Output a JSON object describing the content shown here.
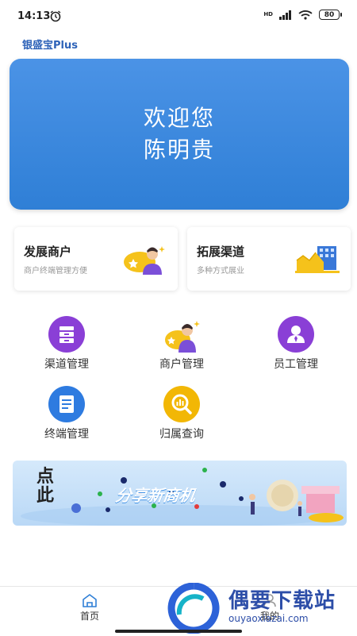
{
  "status": {
    "time": "14:13",
    "network": "HD",
    "battery": "80"
  },
  "app": {
    "title": "银盛宝Plus"
  },
  "welcome": {
    "line1": "欢迎您",
    "line2": "陈明贵"
  },
  "cards": [
    {
      "title": "发展商户",
      "subtitle": "商户终端管理方便",
      "icon": "merchant-avatar-icon"
    },
    {
      "title": "拓展渠道",
      "subtitle": "多种方式展业",
      "icon": "building-chart-icon"
    }
  ],
  "grid": [
    {
      "label": "渠道管理",
      "icon": "cabinet-icon",
      "color": "#8a3fd6"
    },
    {
      "label": "商户管理",
      "icon": "merchant-person-icon",
      "color": "#f2b705"
    },
    {
      "label": "员工管理",
      "icon": "staff-icon",
      "color": "#8a3fd6"
    },
    {
      "label": "终端管理",
      "icon": "document-icon",
      "color": "#2e7be0"
    },
    {
      "label": "归属查询",
      "icon": "search-chart-icon",
      "color": "#f2b705"
    }
  ],
  "promo": {
    "left_text": "点此",
    "main_text": "分享新商机"
  },
  "tabs": [
    {
      "label": "首页",
      "icon": "home-icon"
    },
    {
      "label": "我的",
      "icon": "profile-icon"
    }
  ],
  "watermark": {
    "title": "偶要下载站",
    "url": "ouyaoxiazai.com"
  },
  "colors": {
    "primary": "#2f7fd6",
    "purple": "#8a3fd6",
    "yellow": "#f2b705"
  }
}
